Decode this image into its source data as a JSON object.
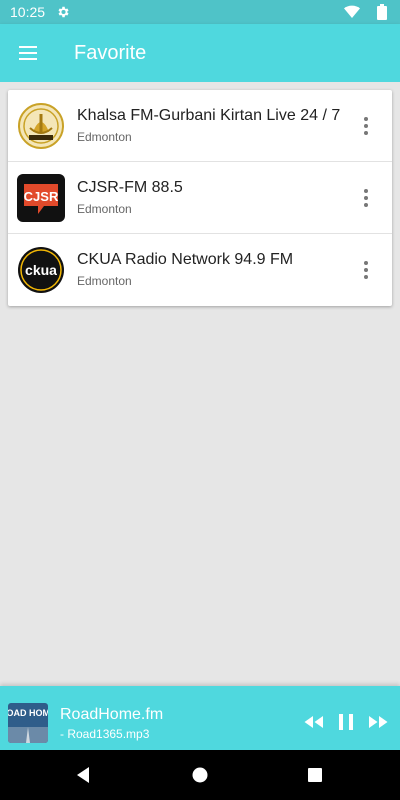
{
  "status_bar": {
    "time": "10:25",
    "icons": [
      "gear-icon",
      "wifi-icon",
      "battery-icon"
    ]
  },
  "app_bar": {
    "title": "Favorite",
    "menu_icon": "hamburger-menu-icon",
    "background_color": "#4fd8de"
  },
  "stations": [
    {
      "name": "Khalsa FM-Gurbani Kirtan Live 24 / 7",
      "city": "Edmonton",
      "logo": "khalsa-fm-logo"
    },
    {
      "name": "CJSR-FM 88.5",
      "city": "Edmonton",
      "logo": "cjsr-logo"
    },
    {
      "name": "CKUA Radio Network 94.9 FM",
      "city": "Edmonton",
      "logo": "ckua-logo"
    }
  ],
  "logo_text": {
    "cjsr": "CJSR",
    "ckua": "ckua"
  },
  "player": {
    "title": "RoadHome.fm",
    "subtitle": " - Road1365.mp3",
    "art_text": "ROAD HOME",
    "controls": [
      "rewind-icon",
      "pause-icon",
      "fast-forward-icon"
    ]
  },
  "nav_bar": {
    "buttons": [
      "back-icon",
      "home-icon",
      "recents-icon"
    ]
  }
}
